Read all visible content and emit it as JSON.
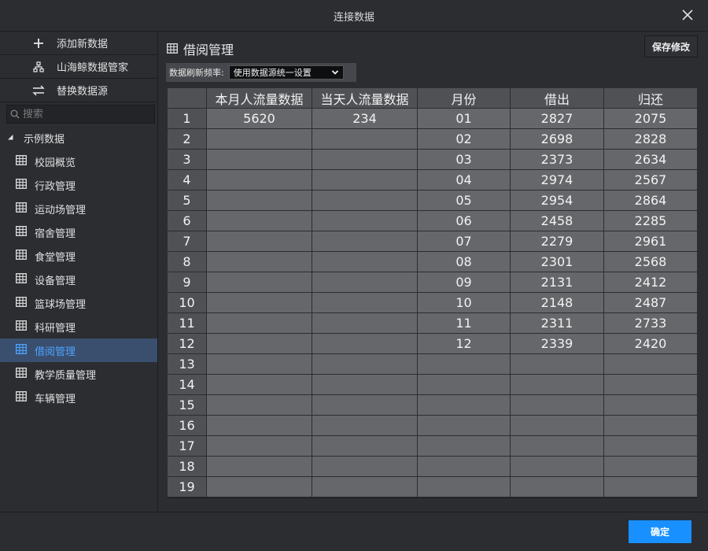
{
  "window": {
    "title": "连接数据"
  },
  "sidebar": {
    "actions": [
      {
        "label": "添加新数据",
        "icon": "plus-icon"
      },
      {
        "label": "山海鲸数据管家",
        "icon": "hierarchy-icon"
      },
      {
        "label": "替换数据源",
        "icon": "swap-icon"
      }
    ],
    "search_placeholder": "搜索",
    "tree_root": "示例数据",
    "items": [
      {
        "label": "校园概览"
      },
      {
        "label": "行政管理"
      },
      {
        "label": "运动场管理"
      },
      {
        "label": "宿舍管理"
      },
      {
        "label": "食堂管理"
      },
      {
        "label": "设备管理"
      },
      {
        "label": "篮球场管理"
      },
      {
        "label": "科研管理"
      },
      {
        "label": "借阅管理",
        "active": true
      },
      {
        "label": "教学质量管理"
      },
      {
        "label": "车辆管理"
      }
    ]
  },
  "main": {
    "title": "借阅管理",
    "save_label": "保存修改",
    "refresh_label": "数据刷新频率:",
    "refresh_value": "使用数据源统一设置"
  },
  "table": {
    "headers": [
      "",
      "本月人流量数据",
      "当天人流量数据",
      "月份",
      "借出",
      "归还"
    ],
    "rows": [
      [
        "1",
        "5620",
        "234",
        "01",
        "2827",
        "2075"
      ],
      [
        "2",
        "",
        "",
        "02",
        "2698",
        "2828"
      ],
      [
        "3",
        "",
        "",
        "03",
        "2373",
        "2634"
      ],
      [
        "4",
        "",
        "",
        "04",
        "2974",
        "2567"
      ],
      [
        "5",
        "",
        "",
        "05",
        "2954",
        "2864"
      ],
      [
        "6",
        "",
        "",
        "06",
        "2458",
        "2285"
      ],
      [
        "7",
        "",
        "",
        "07",
        "2279",
        "2961"
      ],
      [
        "8",
        "",
        "",
        "08",
        "2301",
        "2568"
      ],
      [
        "9",
        "",
        "",
        "09",
        "2131",
        "2412"
      ],
      [
        "10",
        "",
        "",
        "10",
        "2148",
        "2487"
      ],
      [
        "11",
        "",
        "",
        "11",
        "2311",
        "2733"
      ],
      [
        "12",
        "",
        "",
        "12",
        "2339",
        "2420"
      ],
      [
        "13",
        "",
        "",
        "",
        "",
        ""
      ],
      [
        "14",
        "",
        "",
        "",
        "",
        ""
      ],
      [
        "15",
        "",
        "",
        "",
        "",
        ""
      ],
      [
        "16",
        "",
        "",
        "",
        "",
        ""
      ],
      [
        "17",
        "",
        "",
        "",
        "",
        ""
      ],
      [
        "18",
        "",
        "",
        "",
        "",
        ""
      ],
      [
        "19",
        "",
        "",
        "",
        "",
        ""
      ]
    ]
  },
  "footer": {
    "ok_label": "确定"
  },
  "colors": {
    "accent": "#1890ff",
    "active_item_bg": "#3a4f6e",
    "active_item_text": "#4da3ff"
  }
}
